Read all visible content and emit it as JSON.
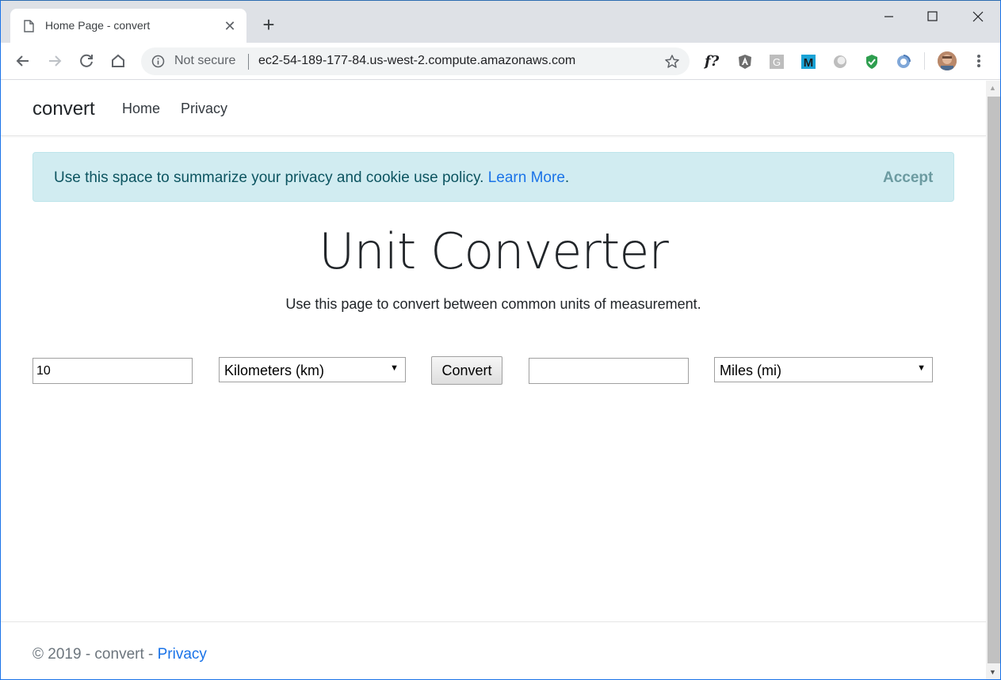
{
  "browser": {
    "tab_title": "Home Page - convert",
    "tab_close": "✕",
    "new_tab": "+",
    "window_controls": {
      "minimize": "—",
      "maximize": "☐",
      "close": "✕"
    },
    "security_label": "Not secure",
    "url": "ec2-54-189-177-84.us-west-2.compute.amazonaws.com",
    "extensions": {
      "fx": "f?",
      "g": "G",
      "m": "M"
    }
  },
  "site": {
    "brand": "convert",
    "nav": {
      "home": "Home",
      "privacy": "Privacy"
    }
  },
  "cookie_banner": {
    "text": "Use this space to summarize your privacy and cookie use policy.",
    "link": "Learn More",
    "trail": ".",
    "accept": "Accept"
  },
  "main": {
    "title": "Unit Converter",
    "subtitle": "Use this page to convert between common units of measurement."
  },
  "converter": {
    "input_value": "10",
    "from_unit": "Kilometers (km)",
    "convert_label": "Convert",
    "output_value": "",
    "to_unit": "Miles (mi)"
  },
  "footer": {
    "text": "© 2019 - convert - ",
    "link": "Privacy"
  },
  "colors": {
    "accent_link": "#1a73e8",
    "alert_bg": "#d1ecf1",
    "alert_text": "#0c5460",
    "tabstrip_bg": "#dee1e6"
  }
}
